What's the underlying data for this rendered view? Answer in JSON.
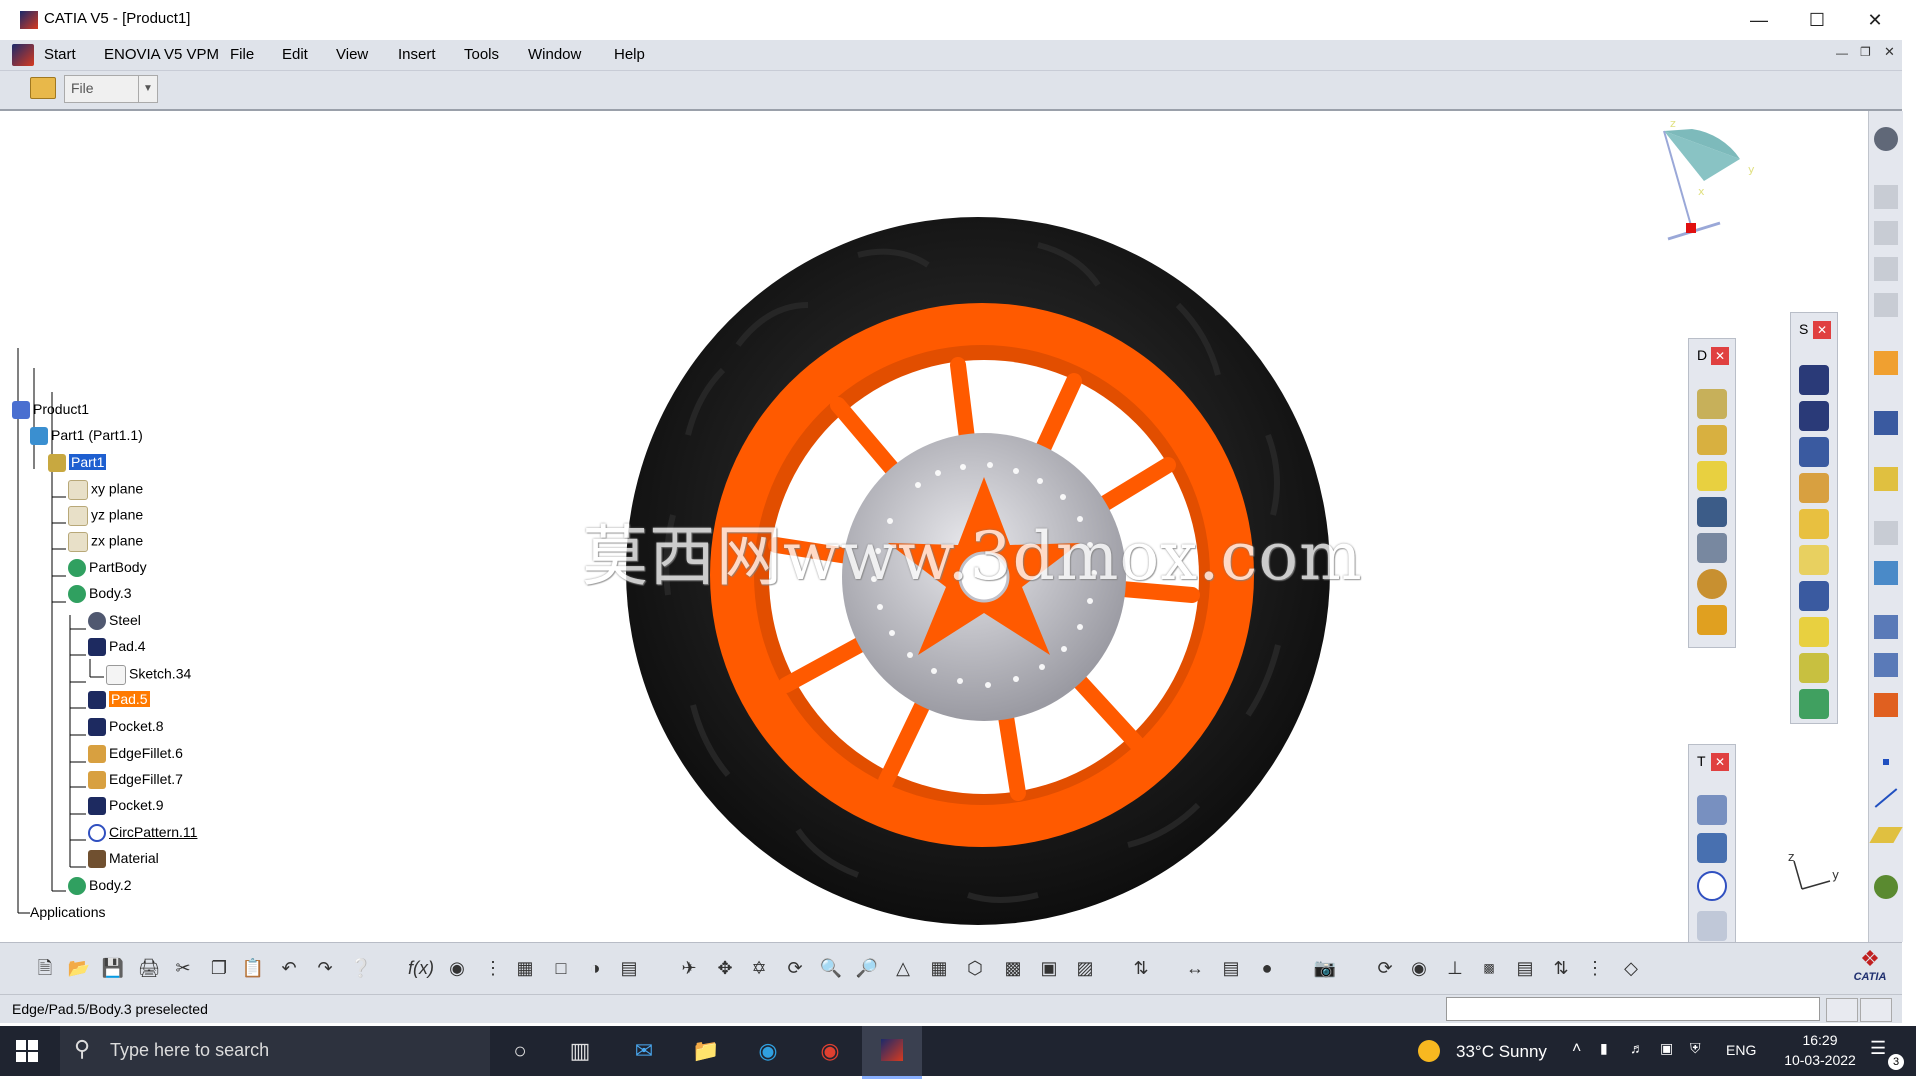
{
  "window": {
    "title": "CATIA V5 - [Product1]",
    "controls": [
      "minimize",
      "maximize",
      "close"
    ]
  },
  "menubar": {
    "items": [
      "Start",
      "ENOVIA V5 VPM",
      "File",
      "Edit",
      "View",
      "Insert",
      "Tools",
      "Window",
      "Help"
    ]
  },
  "toolbar": {
    "file_combo_value": "File"
  },
  "tree": {
    "items": [
      {
        "label": "Product1",
        "icon": "product-icon"
      },
      {
        "label": "Part1 (Part1.1)",
        "icon": "part-instance-icon"
      },
      {
        "label": "Part1",
        "icon": "part-icon",
        "state": "selected"
      },
      {
        "label": "xy plane",
        "icon": "plane-icon"
      },
      {
        "label": "yz plane",
        "icon": "plane-icon"
      },
      {
        "label": "zx plane",
        "icon": "plane-icon"
      },
      {
        "label": "PartBody",
        "icon": "body-icon"
      },
      {
        "label": "Body.3",
        "icon": "body-icon"
      },
      {
        "label": "Steel",
        "icon": "material-icon"
      },
      {
        "label": "Pad.4",
        "icon": "pad-icon"
      },
      {
        "label": "Sketch.34",
        "icon": "sketch-icon"
      },
      {
        "label": "Pad.5",
        "icon": "pad-icon",
        "state": "preselected"
      },
      {
        "label": "Pocket.8",
        "icon": "pocket-icon"
      },
      {
        "label": "EdgeFillet.6",
        "icon": "fillet-icon"
      },
      {
        "label": "EdgeFillet.7",
        "icon": "fillet-icon"
      },
      {
        "label": "Pocket.9",
        "icon": "pocket-icon"
      },
      {
        "label": "CircPattern.11",
        "icon": "circpattern-icon"
      },
      {
        "label": "Material",
        "icon": "material-folder-icon"
      },
      {
        "label": "Body.2",
        "icon": "body-icon"
      },
      {
        "label": "Applications",
        "icon": "none"
      }
    ]
  },
  "viewport": {
    "watermark": "莫西网www.3dmox.com",
    "compass_axes": [
      "z",
      "y",
      "x"
    ],
    "axis_triad": [
      "z",
      "y"
    ]
  },
  "panels": {
    "panel_d": {
      "label": "D"
    },
    "panel_s": {
      "label": "S"
    },
    "panel_t": {
      "label": "T"
    }
  },
  "statusbar": {
    "text": "Edge/Pad.5/Body.3 preselected"
  },
  "brand": {
    "logo_text": "CATIA"
  },
  "taskbar": {
    "search_placeholder": "Type here to search",
    "weather": "33°C  Sunny",
    "language": "ENG",
    "time": "16:29",
    "date": "10-03-2022",
    "notification_count": "3"
  },
  "colors": {
    "rim": "#ff5a00",
    "tire": "#1c1c1c",
    "selection": "#1e5fd0",
    "preselect": "#ff7a00"
  }
}
